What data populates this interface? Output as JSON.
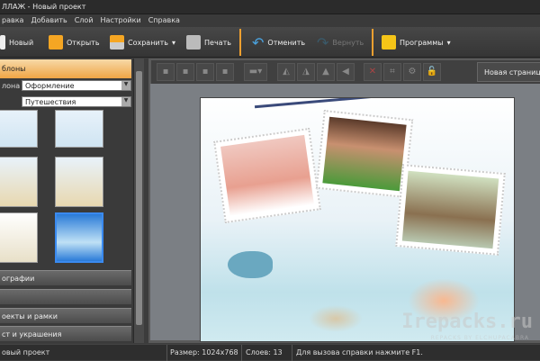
{
  "window": {
    "title": "ЛЛАЖ - Новый проект"
  },
  "menu": [
    "равка",
    "Добавить",
    "Слой",
    "Настройки",
    "Справка"
  ],
  "toolbar": {
    "new": "Новый",
    "open": "Открыть",
    "save": "Сохранить",
    "print": "Печать",
    "undo": "Отменить",
    "redo": "Вернуть",
    "programs": "Программы"
  },
  "left_panel": {
    "header": "блоны",
    "field1_label": "лона",
    "field1_value": "Оформление",
    "field2_value": "Путешествия",
    "sections": [
      "ографии",
      "",
      "оекты и рамки",
      "ст и украшения"
    ]
  },
  "canvas_toolbar": {
    "new_page": "Новая страница"
  },
  "status": {
    "project": "овый проект",
    "size": "Размер: 1024x768",
    "layers": "Слоев: 13",
    "hint": "Для вызова справки нажмите F1."
  },
  "watermark": {
    "main": "Irepacks.ru",
    "sub": "REPACKS BY ELCHUPACABRA"
  }
}
